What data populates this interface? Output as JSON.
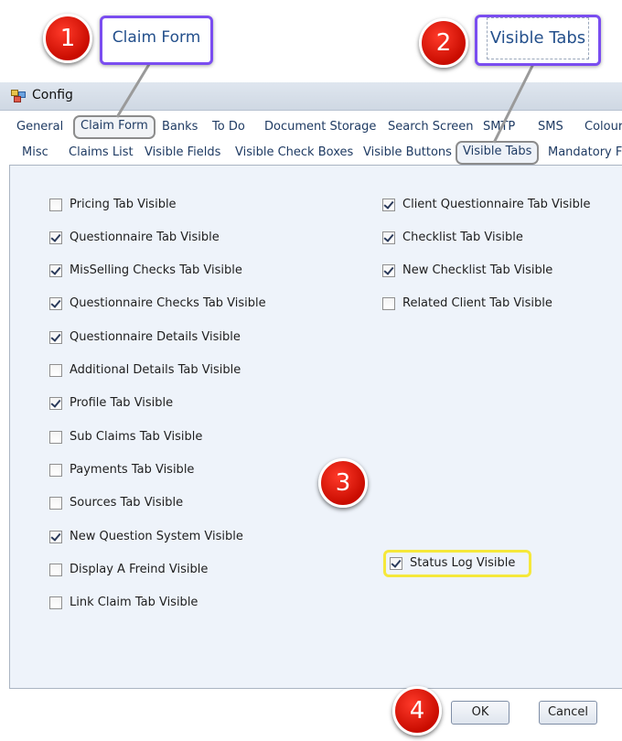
{
  "window": {
    "title": "Config"
  },
  "tabs_row1": [
    "General",
    "Claim Form",
    "Banks",
    "To Do",
    "Document Storage",
    "Search Screen",
    "SMTP",
    "SMS",
    "Colour"
  ],
  "tabs_row2": [
    "Misc",
    "Claims List",
    "Visible Fields",
    "Visible Check Boxes",
    "Visible Buttons",
    "Visible Tabs",
    "Mandatory Fi"
  ],
  "left_checkboxes": [
    {
      "label": "Pricing Tab Visible",
      "checked": false
    },
    {
      "label": "Questionnaire Tab Visible",
      "checked": true
    },
    {
      "label": "MisSelling Checks Tab Visible",
      "checked": true
    },
    {
      "label": "Questionnaire Checks Tab Visible",
      "checked": true
    },
    {
      "label": "Questionnaire Details Visible",
      "checked": true
    },
    {
      "label": "Additional Details Tab Visible",
      "checked": false
    },
    {
      "label": "Profile Tab Visible",
      "checked": true
    },
    {
      "label": "Sub Claims Tab Visible",
      "checked": false
    },
    {
      "label": "Payments Tab Visible",
      "checked": false
    },
    {
      "label": "Sources Tab Visible",
      "checked": false
    },
    {
      "label": "New Question System Visible",
      "checked": true
    },
    {
      "label": "Display A Freind Visible",
      "checked": false
    },
    {
      "label": "Link Claim Tab Visible",
      "checked": false
    }
  ],
  "right_checkboxes": [
    {
      "label": "Client Questionnaire Tab Visible",
      "checked": true
    },
    {
      "label": "Checklist Tab Visible",
      "checked": true
    },
    {
      "label": "New Checklist Tab Visible",
      "checked": true
    },
    {
      "label": "Related Client Tab Visible",
      "checked": false
    }
  ],
  "status_log": {
    "label": "Status Log Visible",
    "checked": true
  },
  "buttons": {
    "ok": "OK",
    "cancel": "Cancel"
  },
  "annotations": {
    "badge1": "1",
    "badge2": "2",
    "badge3": "3",
    "badge4": "4",
    "callout1": "Claim Form",
    "callout2": "Visible Tabs"
  },
  "colors": {
    "callout_border": "#7a4df0",
    "badge_red": "#e01a0a",
    "status_highlight": "#f5e83a"
  }
}
